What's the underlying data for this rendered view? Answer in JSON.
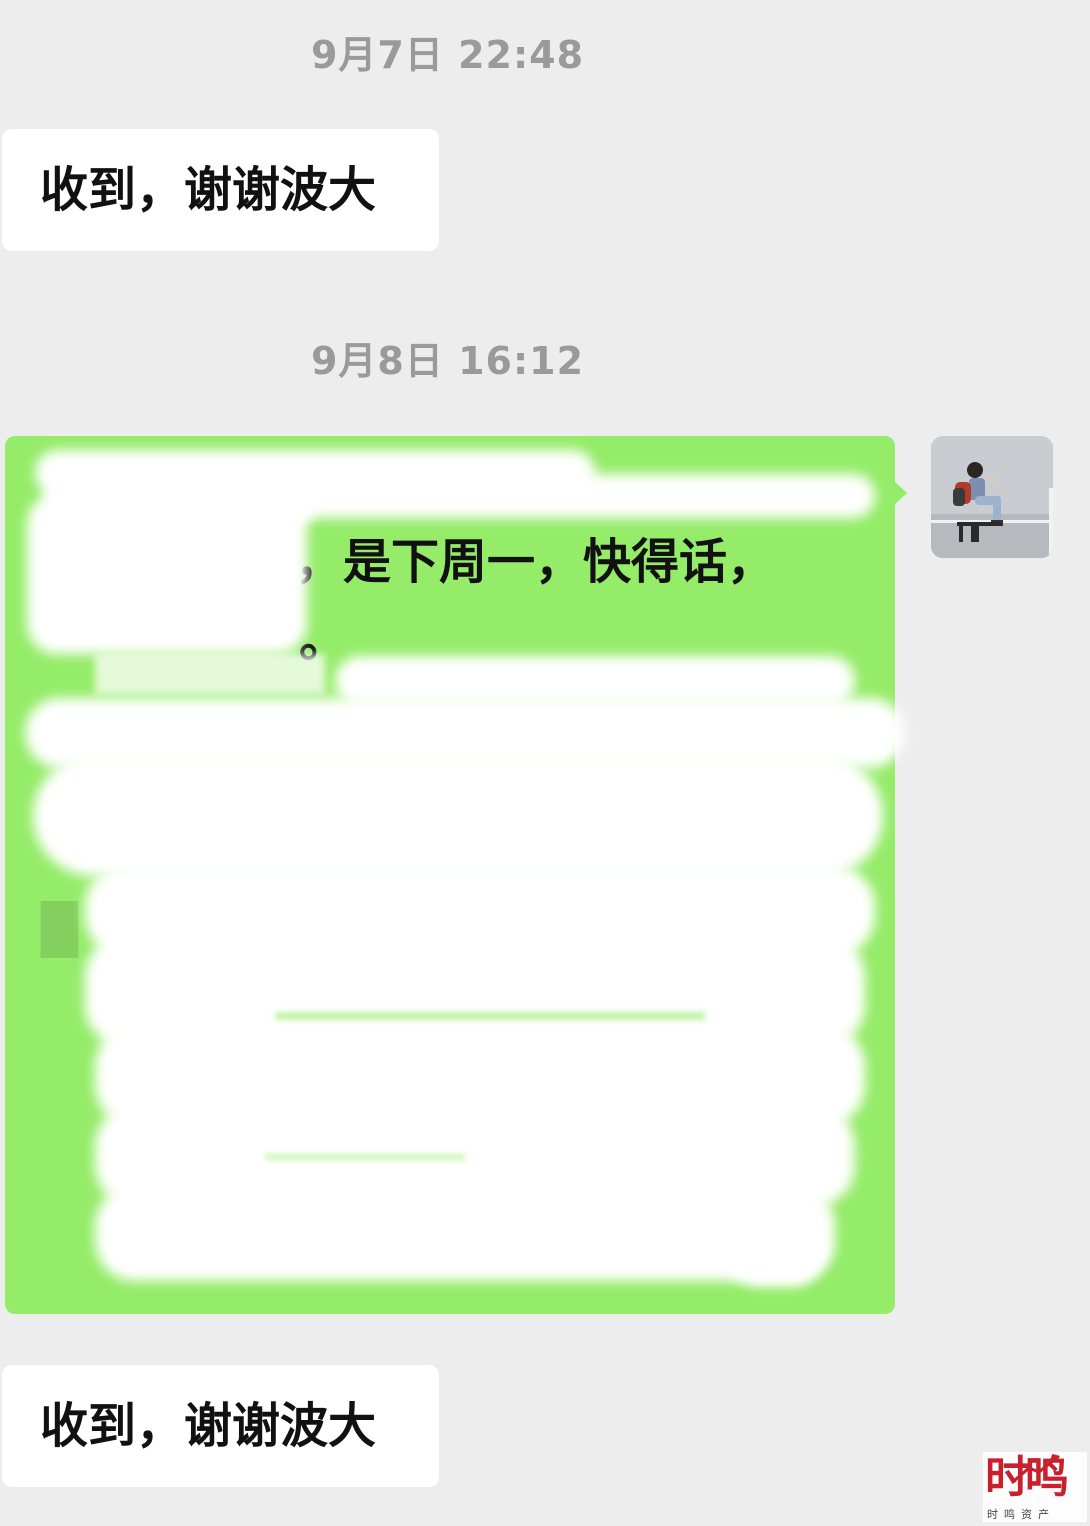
{
  "timestamps": [
    "9月7日 22:48",
    "9月8日 16:12"
  ],
  "messages": {
    "incoming_1": "收到，谢谢波大",
    "outgoing_visible_line_1": "，是下周一，快得话，",
    "outgoing_visible_line_2": "。",
    "incoming_2": "收到，谢谢波大"
  },
  "colors": {
    "background": "#ededed",
    "incoming_bubble": "#ffffff",
    "outgoing_bubble": "#95ec69",
    "timestamp_text": "#9a9a9a"
  },
  "watermark": {
    "brand": "时鸣",
    "sub": "时鸣资产"
  }
}
